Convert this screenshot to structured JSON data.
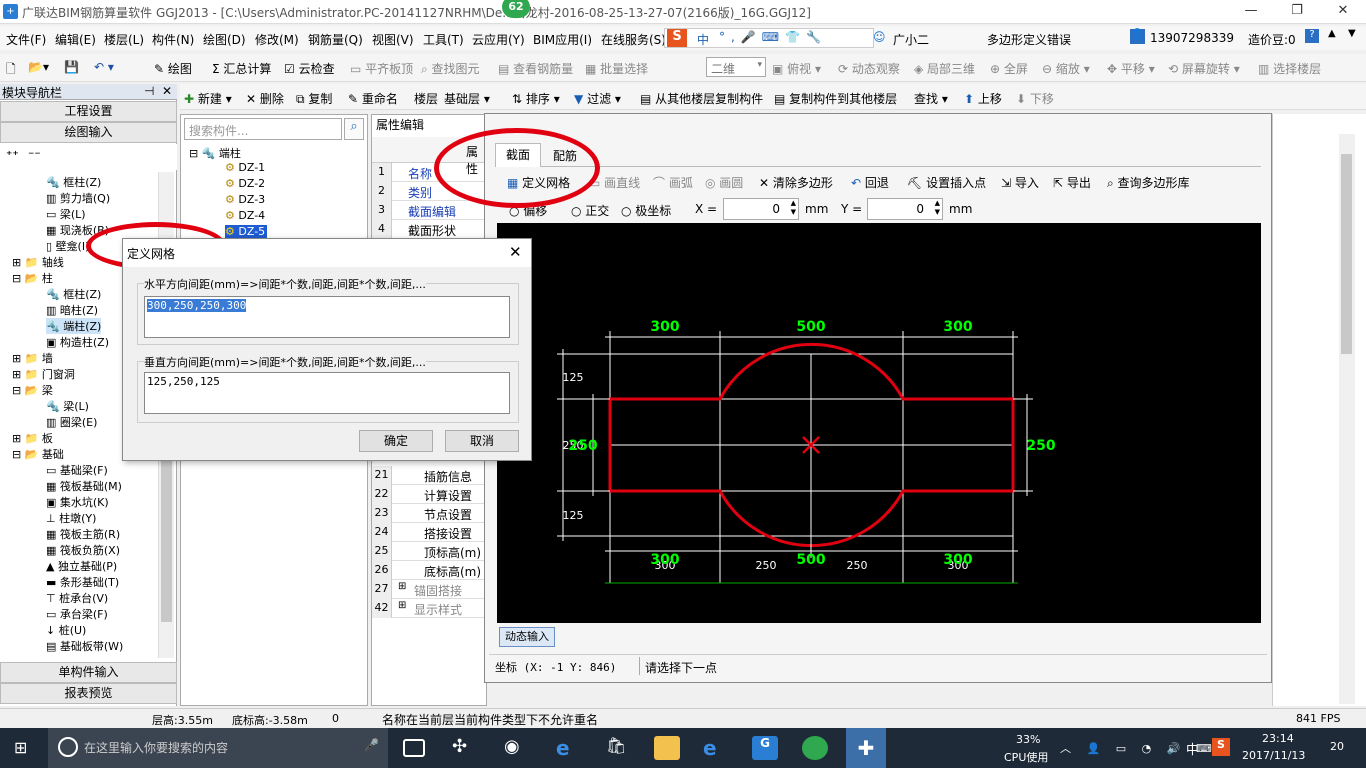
{
  "app": {
    "title": "广联达BIM钢筋算量软件 GGJ2013 - [C:\\Users\\Administrator.PC-20141127NRHM\\De...白龙村-2016-08-25-13-27-07(2166版)_16G.GGJ12]",
    "badge": "62"
  },
  "menu": {
    "items": [
      "文件(F)",
      "编辑(E)",
      "楼层(L)",
      "构件(N)",
      "绘图(D)",
      "修改(M)",
      "钢筋量(Q)",
      "视图(V)",
      "工具(T)",
      "云应用(Y)",
      "BIM应用(I)",
      "在线服务(S)"
    ],
    "ime_label": "中",
    "xiaoer": "广小二",
    "error_text": "多边形定义错误",
    "phone": "13907298339",
    "price_label": "造价豆:0"
  },
  "toolbar": {
    "draw": "绘图",
    "summary": "汇总计算",
    "cloud_check": "云检查",
    "flat_top": "平齐板顶",
    "find_elem": "查找图元",
    "view_rebar": "查看钢筋量",
    "batch_select": "批量选择",
    "view_mode": "二维",
    "view_dir": "俯视",
    "dyn_view": "动态观察",
    "local_3d": "局部三维",
    "full_screen": "全屏",
    "zoom": "缩放",
    "pan": "平移",
    "rotate": "屏幕旋转",
    "select_floor": "选择楼层"
  },
  "toolbar2": {
    "new": "新建",
    "delete": "删除",
    "copy": "复制",
    "rename": "重命名",
    "floor": "楼层",
    "floor_value": "基础层",
    "sort": "排序",
    "filter": "过滤",
    "copy_from": "从其他楼层复制构件",
    "copy_to": "复制构件到其他楼层",
    "find": "查找",
    "up": "上移",
    "down": "下移"
  },
  "nav": {
    "header": "模块导航栏",
    "project_settings": "工程设置",
    "draw_input": "绘图输入",
    "single_input": "单构件输入",
    "report_preview": "报表预览",
    "tree": [
      "框柱(Z)",
      "剪力墙(Q)",
      "梁(L)",
      "现浇板(B)",
      "壁龛(I)",
      "轴线",
      "柱",
      "框柱(Z)",
      "暗柱(Z)",
      "端柱(Z)",
      "构造柱(Z)",
      "墙",
      "门窗洞",
      "梁",
      "梁(L)",
      "圈梁(E)",
      "板",
      "基础",
      "基础梁(F)",
      "筏板基础(M)",
      "集水坑(K)",
      "柱墩(Y)",
      "筏板主筋(R)",
      "筏板负筋(X)",
      "独立基础(P)",
      "条形基础(T)",
      "桩承台(V)",
      "承台梁(F)",
      "桩(U)",
      "基础板带(W)"
    ]
  },
  "components": {
    "search_placeholder": "搜索构件...",
    "root": "端柱",
    "items": [
      "DZ-1",
      "DZ-2",
      "DZ-3",
      "DZ-4",
      "DZ-5"
    ]
  },
  "props": {
    "tab": "属性编辑",
    "col_header": "属性",
    "rows": [
      {
        "n": "1",
        "t": "名称"
      },
      {
        "n": "2",
        "t": "类别"
      },
      {
        "n": "3",
        "t": "截面编辑"
      },
      {
        "n": "4",
        "t": "截面形状"
      }
    ],
    "rows2": [
      {
        "n": "21",
        "t": "插筋信息"
      },
      {
        "n": "22",
        "t": "计算设置"
      },
      {
        "n": "23",
        "t": "节点设置"
      },
      {
        "n": "24",
        "t": "搭接设置"
      },
      {
        "n": "25",
        "t": "顶标高(m)"
      },
      {
        "n": "26",
        "t": "底标高(m)"
      },
      {
        "n": "27",
        "t": "锚固搭接"
      },
      {
        "n": "42",
        "t": "显示样式"
      }
    ]
  },
  "poly": {
    "tab_section": "截面",
    "tab_rebar": "配筋",
    "define_grid": "定义网格",
    "draw_line": "画直线",
    "draw_arc": "画弧",
    "draw_circle": "画圆",
    "clear_poly": "清除多边形",
    "undo": "回退",
    "set_insert": "设置插入点",
    "import": "导入",
    "export": "导出",
    "query_lib": "查询多边形库",
    "offset": "偏移",
    "ortho": "正交",
    "polar": "极坐标",
    "x_label": "X =",
    "x_value": "0",
    "y_label": "Y =",
    "y_value": "0",
    "unit": "mm",
    "dyn_input": "动态输入",
    "coord": "坐标 (X: -1 Y: 846)",
    "prompt": "请选择下一点"
  },
  "dims": {
    "top": [
      "300",
      "500",
      "300"
    ],
    "bottom_green": [
      "300",
      "500",
      "300"
    ],
    "bottom_white": [
      "300",
      "250",
      "250",
      "300"
    ],
    "left_white": [
      "125",
      "250",
      "125"
    ],
    "left_green": "250",
    "right_green": "250"
  },
  "dialog": {
    "title": "定义网格",
    "h_label": "水平方向间距(mm)=>间距*个数,间距,间距*个数,间距,...",
    "h_value": "300,250,250,300",
    "v_label": "垂直方向间距(mm)=>间距*个数,间距,间距*个数,间距,...",
    "v_value": "125,250,125",
    "ok": "确定",
    "cancel": "取消"
  },
  "status": {
    "floor_height": "层高:3.55m",
    "bottom_elev": "底标高:-3.58m",
    "zero": "0",
    "message": "名称在当前层当前构件类型下不允许重名",
    "fps": "841 FPS"
  },
  "taskbar": {
    "search_placeholder": "在这里输入你要搜索的内容",
    "cpu_percent": "33%",
    "cpu_label": "CPU使用",
    "ime": "中",
    "time": "23:14",
    "date": "2017/11/13",
    "notif": "20"
  },
  "colors": {
    "red_shape": "#e00010",
    "green_dim": "#00ff00",
    "grid": "#ffffff",
    "annotation": "#e00010"
  }
}
